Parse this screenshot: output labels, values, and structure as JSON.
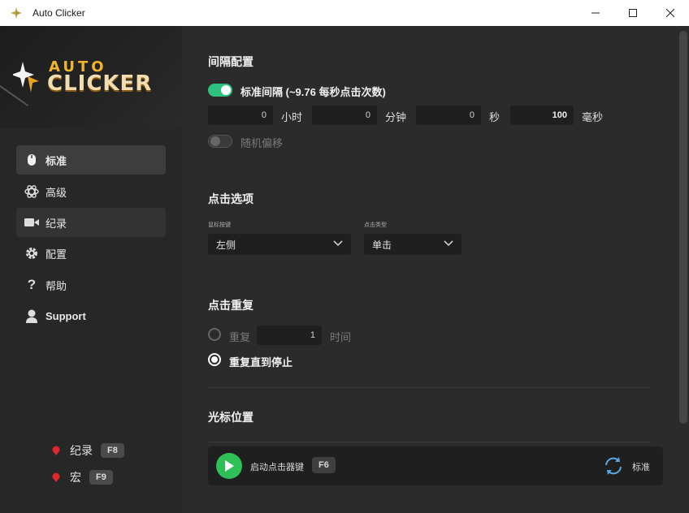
{
  "window": {
    "title": "Auto Clicker"
  },
  "logo": {
    "line1": "AUTO",
    "line2": "CLICKER"
  },
  "sidebar": {
    "items": [
      {
        "label": "标准",
        "icon": "mouse-icon",
        "state": "active"
      },
      {
        "label": "高级",
        "icon": "atom-icon",
        "state": "normal"
      },
      {
        "label": "纪录",
        "icon": "video-camera-icon",
        "state": "hover"
      },
      {
        "label": "配置",
        "icon": "gear-icon",
        "state": "normal"
      },
      {
        "label": "帮助",
        "icon": "question-icon",
        "state": "normal"
      },
      {
        "label": "Support",
        "icon": "support-person-icon",
        "state": "normal"
      }
    ],
    "hotkeys": [
      {
        "label": "纪录",
        "key": "F8"
      },
      {
        "label": "宏",
        "key": "F9"
      }
    ]
  },
  "interval": {
    "title": "间隔配置",
    "standard_label": "标准间隔 (~9.76 每秒点击次数)",
    "standard_on": true,
    "hours_value": "0",
    "hours_unit": "小时",
    "minutes_value": "0",
    "minutes_unit": "分钟",
    "seconds_value": "0",
    "seconds_unit": "秒",
    "ms_value": "100",
    "ms_unit": "毫秒",
    "random_label": "随机偏移",
    "random_on": false
  },
  "click_options": {
    "title": "点击选项",
    "button_label": "鼠标按键",
    "button_value": "左侧",
    "type_label": "点击类型",
    "type_value": "单击"
  },
  "repeat": {
    "title": "点击重复",
    "repeat_label": "重复",
    "repeat_value": "1",
    "repeat_unit": "时间",
    "until_stop_label": "重复直到停止",
    "selected": "until_stop"
  },
  "cursor": {
    "title": "光标位置"
  },
  "bottom": {
    "start_label": "启动点击器键",
    "start_key": "F6",
    "mode_label": "标准"
  },
  "colors": {
    "accent_green": "#2ec27e",
    "play_green": "#2ebf57",
    "logo_gold": "#f0b52a",
    "record_red": "#e0262f"
  }
}
